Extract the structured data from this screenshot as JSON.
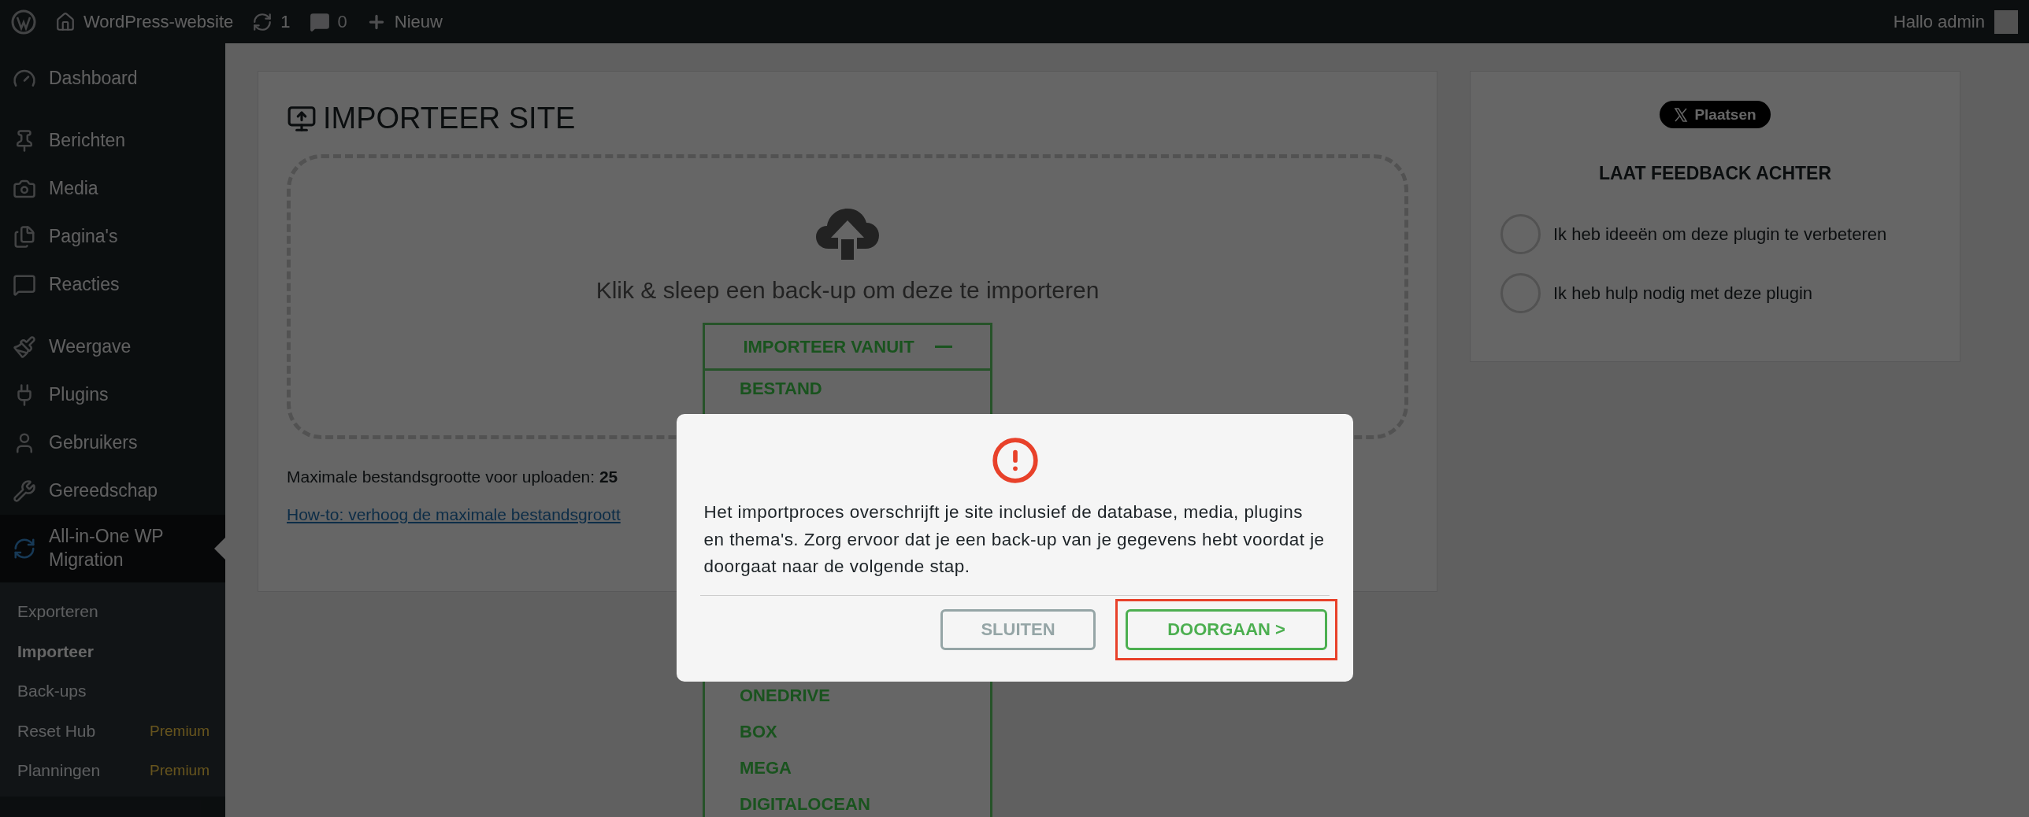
{
  "admin_bar": {
    "site_name": "WordPress-website",
    "updates": "1",
    "comments": "0",
    "new": "Nieuw",
    "greeting": "Hallo admin"
  },
  "sidebar": {
    "sections": [
      {
        "items": [
          {
            "label": "Dashboard",
            "selected": false
          }
        ]
      },
      {
        "items": [
          {
            "label": "Berichten",
            "selected": false
          },
          {
            "label": "Media",
            "selected": false
          },
          {
            "label": "Pagina's",
            "selected": false
          },
          {
            "label": "Reacties",
            "selected": false
          }
        ]
      },
      {
        "items": [
          {
            "label": "Weergave",
            "selected": false
          },
          {
            "label": "Plugins",
            "selected": false
          },
          {
            "label": "Gebruikers",
            "selected": false
          },
          {
            "label": "Gereedschap",
            "selected": false
          },
          {
            "label": "All-in-One WP Migration",
            "selected": true,
            "children": [
              {
                "label": "Exporteren",
                "selected": false
              },
              {
                "label": "Importeer",
                "selected": true
              },
              {
                "label": "Back-ups",
                "selected": false
              },
              {
                "label": "Reset Hub",
                "selected": false,
                "badge": "Premium"
              },
              {
                "label": "Planningen",
                "selected": false,
                "badge": "Premium"
              }
            ]
          }
        ]
      }
    ]
  },
  "import_panel": {
    "title": "IMPORTEER SITE",
    "drop_text": "Klik & sleep een back-up om deze te importeren",
    "import_from": {
      "label": "IMPORTEER VANUIT",
      "expanded": true,
      "options": [
        "BESTAND",
        "ONEDRIVE",
        "BOX",
        "MEGA",
        "DIGITALOCEAN"
      ]
    },
    "max_size": "Maximale bestandsgrootte voor uploaden: **25**",
    "howto_link": "How-to: verhoog de maximale bestandsgroott"
  },
  "feedback_panel": {
    "share_button": "Plaatsen",
    "title": "LAAT FEEDBACK ACHTER",
    "options": [
      {
        "label": "Ik heb ideeën om deze plugin te verbeteren",
        "selected": false
      },
      {
        "label": "Ik heb hulp nodig met deze plugin",
        "selected": false
      }
    ]
  },
  "modal": {
    "message": "Het importproces overschrijft je site inclusief de database, media, plugins en thema's. Zorg ervoor dat je een back-up van je gegevens hebt voordat je doorgaat naar de volgende stap.",
    "buttons": [
      {
        "label": "SLUITEN",
        "kind": "secondary",
        "highlighted": false
      },
      {
        "label": "DOORGAAN >",
        "kind": "primary",
        "highlighted": true
      }
    ]
  }
}
